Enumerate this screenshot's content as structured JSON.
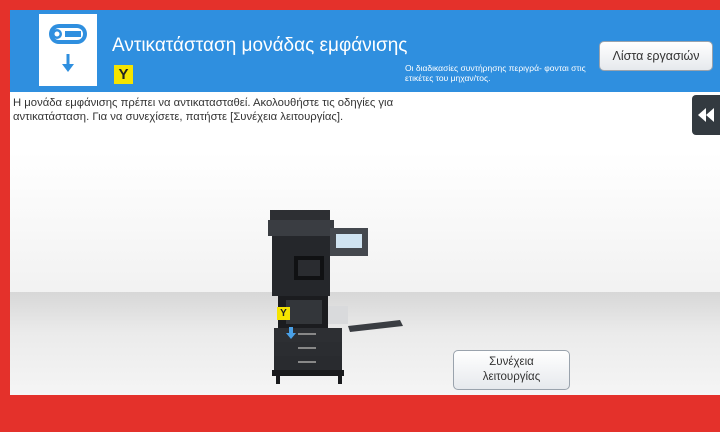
{
  "header": {
    "title": "Αντικατάσταση μονάδας εμφάνισης",
    "color_badge": "Y",
    "note": "Οι διαδικασίες συντήρησης περιγρά- φονται στις ετικέτες του μηχαν/τος.",
    "job_list_label": "Λίστα εργασιών",
    "icon": "toner-cartridge-icon"
  },
  "message": {
    "text": "Η μονάδα εμφάνισης πρέπει να αντικατασταθεί. Ακολουθήστε τις οδηγίες για αντικατάσταση. Για να συνεχίσετε, πατήστε [Συνέχεια λειτουργίας]."
  },
  "side_panel": {
    "icon": "rewind-icon"
  },
  "illustration": {
    "marker_label": "Y",
    "printer_icon": "multifunction-printer-icon"
  },
  "actions": {
    "continue_label_line1": "Συνέχεια",
    "continue_label_line2": "λειτουργίας"
  },
  "colors": {
    "header_blue": "#2f8fdf",
    "frame_red": "#e4312b",
    "badge_yellow": "#f5e400"
  }
}
